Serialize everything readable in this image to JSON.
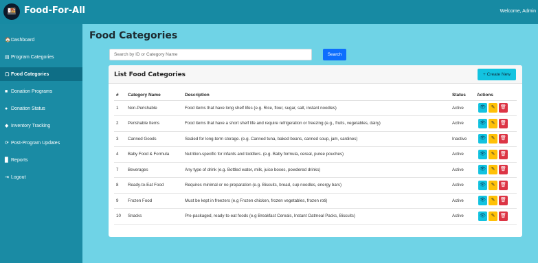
{
  "app": {
    "title": "Food-For-All",
    "welcome": "Welcome, Admin"
  },
  "sidebar": {
    "items": [
      {
        "label": "Dashboard",
        "icon": "home-icon",
        "glyph": "🏠"
      },
      {
        "label": "Program Categories",
        "icon": "list-icon",
        "glyph": "▤"
      },
      {
        "label": "Food Categories",
        "icon": "calendar-icon",
        "glyph": "▢"
      },
      {
        "label": "Donation Programs",
        "icon": "box-icon",
        "glyph": "■"
      },
      {
        "label": "Donation Status",
        "icon": "circle-check-icon",
        "glyph": "●"
      },
      {
        "label": "Inventory Tracking",
        "icon": "diamond-icon",
        "glyph": "◆"
      },
      {
        "label": "Post-Program Updates",
        "icon": "refresh-icon",
        "glyph": "⟳"
      },
      {
        "label": "Reports",
        "icon": "document-icon",
        "glyph": "▉"
      },
      {
        "label": "Logout",
        "icon": "logout-icon",
        "glyph": "⇥"
      }
    ],
    "active_index": 2
  },
  "page": {
    "title": "Food Categories"
  },
  "search": {
    "placeholder": "Search by ID or Category Name",
    "button_label": "Search"
  },
  "card": {
    "title": "List Food Categories",
    "create_label": "+ Create New"
  },
  "table": {
    "headers": {
      "num": "#",
      "name": "Category Name",
      "description": "Description",
      "status": "Status",
      "actions": "Actions"
    },
    "rows": [
      {
        "id": "1",
        "name": "Non-Perishable",
        "description": "Food items that have long shelf lifes (e.g. Rice, flour, sugar, salt, instant noodles)",
        "status": "Active"
      },
      {
        "id": "2",
        "name": "Perishable Items",
        "description": "Food items that have a short shelf life and require refrigeration or freezing (e.g., fruits, vegetables, dairy)",
        "status": "Active"
      },
      {
        "id": "3",
        "name": "Canned Goods",
        "description": "Sealed for long-term storage. (e.g. Canned tuna, baked beans, canned soup, jam, sardines)",
        "status": "Inactive"
      },
      {
        "id": "4",
        "name": "Baby Food & Formula",
        "description": "Nutrition-specific for infants and toddlers. (e.g. Baby formula, cereal, puree pouches)",
        "status": "Active"
      },
      {
        "id": "7",
        "name": "Beverages",
        "description": "Any type of drink (e.g. Bottled water, milk, juice boxes, powdered drinks)",
        "status": "Active"
      },
      {
        "id": "8",
        "name": "Ready-to-Eat Food",
        "description": "Requires minimal or no preparation (e.g. Biscuits, bread, cup noodles, energy bars)",
        "status": "Active"
      },
      {
        "id": "9",
        "name": "Frozen Food",
        "description": "Must be kept in freezers (e.g Frozen chicken, frozen vegetables, frozen roti)",
        "status": "Active"
      },
      {
        "id": "10",
        "name": "Snacks",
        "description": "Pre-packaged, ready-to-eat foods (e.g Breakfast Cereals, Instant Oatmeal Packs, Biscuits)",
        "status": "Active"
      }
    ],
    "action_icons": {
      "view": "eye-icon",
      "edit": "pencil-icon",
      "delete": "trash-icon"
    }
  },
  "colors": {
    "topbar": "#178aa3",
    "sidebar": "#1a8ba4",
    "background": "#6fd3e6",
    "primary": "#0d6efd",
    "info": "#13c3e0",
    "warning": "#ffc107",
    "danger": "#dc3545"
  }
}
